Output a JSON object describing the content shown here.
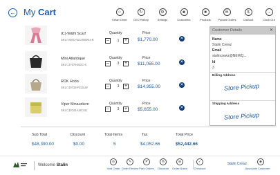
{
  "header": {
    "title_prefix": "My",
    "title_main": "Cart"
  },
  "top_nav": [
    {
      "label": "Smart Order",
      "icon": "smart-order-icon"
    },
    {
      "label": "CEO History",
      "icon": "history-icon"
    },
    {
      "label": "Settings",
      "icon": "settings-icon"
    },
    {
      "label": "Customers",
      "icon": "customers-icon"
    },
    {
      "label": "Products",
      "icon": "products-icon"
    },
    {
      "label": "Parked Orders",
      "icon": "parked-orders-icon"
    },
    {
      "label": "Cashout",
      "icon": "cashout-icon"
    },
    {
      "label": "Clock Out",
      "icon": "clock-out-icon"
    }
  ],
  "cart": {
    "quantity_label": "Quantity",
    "price_label": "Price",
    "items": [
      {
        "name": "(C)-W&N Scarf",
        "sku": "SKU: WSCASC000001-R",
        "quantity": "1",
        "price": "$1,770.00"
      },
      {
        "name": "Mini Atlantique",
        "sku": "SKU: 27079-BOC-K",
        "quantity": "3",
        "price": "$11,055.00"
      },
      {
        "name": "RDK Hobo",
        "sku": "SKU: 30733-RCBLW",
        "quantity": "3",
        "price": "$14,955.00"
      },
      {
        "name": "Viper Minaudiere",
        "sku": "SKU: 30744-LBCSG",
        "quantity": "3",
        "price": "$5,655.00"
      }
    ]
  },
  "customer": {
    "header": "Customer Details",
    "name_label": "Name",
    "name": "Stalin Crewz",
    "email_label": "Email",
    "email": "stalincrewz@NEWQ...",
    "id_label": "Id",
    "id": "3",
    "billing_label": "Billing Address",
    "billing_value": "Store Pickup",
    "shipping_label": "Shipping Address",
    "shipping_value": "Store Pickup"
  },
  "totals": {
    "sub_total_label": "Sub Total",
    "sub_total": "$48,390.00",
    "discount_label": "Discount",
    "discount": "$0.00",
    "total_items_label": "Total Items",
    "total_items": "5",
    "tax_label": "Tax",
    "tax": "$4,052.66",
    "total_price_label": "Total Price",
    "total_price": "$52,442.66"
  },
  "footer": {
    "welcome_prefix": "Welcome",
    "user": "Stalin",
    "actions": [
      {
        "label": "Void Order",
        "icon": "void-order-icon"
      },
      {
        "label": "Order Review",
        "icon": "order-review-icon"
      },
      {
        "label": "Park Orders",
        "icon": "park-orders-icon"
      },
      {
        "label": "Discount",
        "icon": "discount-icon"
      },
      {
        "label": "Order Notes",
        "icon": "order-notes-icon"
      },
      {
        "label": "Checkout",
        "icon": "checkout-icon"
      }
    ],
    "customer_name": "Stalin Crewz",
    "associate_label": "Associate Customer"
  },
  "colors": {
    "accent": "#1a5aa5",
    "remove_button": "#0f3a72",
    "panel_header": "#c9c9c9"
  }
}
